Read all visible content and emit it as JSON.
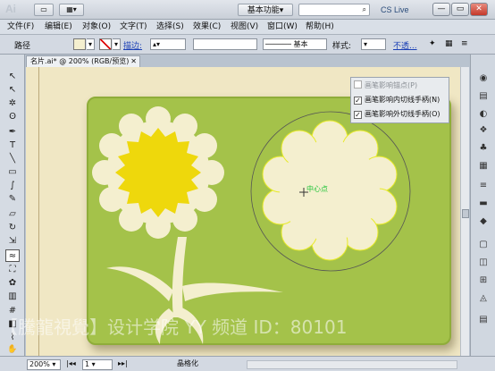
{
  "app": {
    "logo": "Ai",
    "workspace": "基本功能",
    "workspace_arrow": "▾",
    "search_glyph": "⌕",
    "cslive": "CS Live",
    "window_controls": [
      "—",
      "▭",
      "✕"
    ]
  },
  "menu": [
    "文件(F)",
    "编辑(E)",
    "对象(O)",
    "文字(T)",
    "选择(S)",
    "效果(C)",
    "视图(V)",
    "窗口(W)",
    "帮助(H)"
  ],
  "controlbar": {
    "object_label": "路径",
    "stroke_label": "描边:",
    "stroke_style": "基本",
    "style_label": "样式:",
    "opacity_label": "不透..."
  },
  "document": {
    "tab_title": "名片.ai* @ 200% (RGB/预览)",
    "tab_close": "✕",
    "center_label": "中心点"
  },
  "context_menu": {
    "items": [
      {
        "label": "画笔影响锚点(P)",
        "checked": false
      },
      {
        "label": "画笔影响内切线手柄(N)",
        "checked": true
      },
      {
        "label": "画笔影响外切线手柄(O)",
        "checked": true
      }
    ]
  },
  "watermark": "【騰龍視覺】设计学院  YY 频道 ID：80101",
  "status": {
    "zoom": "200%",
    "page": "1",
    "tool_name": "晶格化"
  },
  "colors": {
    "card_green": "#a4c24a",
    "canvas_bg": "#f0e7c4",
    "petal_cream": "#f6f0d0",
    "sun_yellow": "#eed80c",
    "accent_link": "#1a3fb5"
  },
  "icons": {
    "selection": "↖",
    "direct_select": "↖",
    "magic_wand": "✲",
    "lasso": "ʘ",
    "pen": "✒",
    "type": "T",
    "line": "╲",
    "rect": "▭",
    "brush": "∫",
    "pencil": "✎",
    "eraser": "▱",
    "rotate": "↻",
    "scale": "⇲",
    "warp": "≈",
    "free_transform": "⛶",
    "symbol": "✿",
    "graph": "▥",
    "mesh": "#",
    "gradient": "◧",
    "eyedropper": "⌇",
    "blend": "∞",
    "slice": "✂",
    "hand": "✋",
    "zoom": "⌕",
    "fill": "■",
    "stroke": "□",
    "screen_mode": "▣",
    "right_1": "◉",
    "right_2": "▤",
    "right_3": "◐",
    "right_4": "❖",
    "right_5": "♣",
    "right_6": "▦",
    "right_7": "✦",
    "right_8": "≡",
    "right_9": "▬",
    "right_10": "◆",
    "right_11": "▢",
    "right_12": "◫",
    "right_13": "⊞",
    "right_14": "◬"
  }
}
